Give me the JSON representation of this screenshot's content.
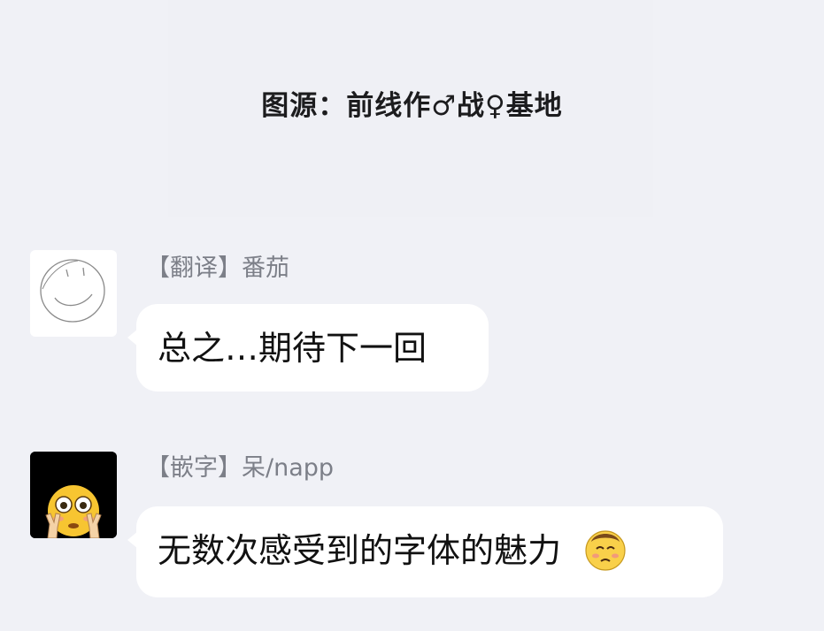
{
  "header": {
    "source_text": "图源：前线作♂战♀基地"
  },
  "messages": [
    {
      "sender": "【翻译】番茄",
      "text": "总之…期待下一回",
      "avatar_icon": "smiley-sketch-icon"
    },
    {
      "sender": "【嵌字】呆/napp",
      "text": "无数次感受到的字体的魅力",
      "avatar_icon": "flushed-face-peace-icon",
      "trailing_emoji": "woozy-face-emoji"
    }
  ]
}
